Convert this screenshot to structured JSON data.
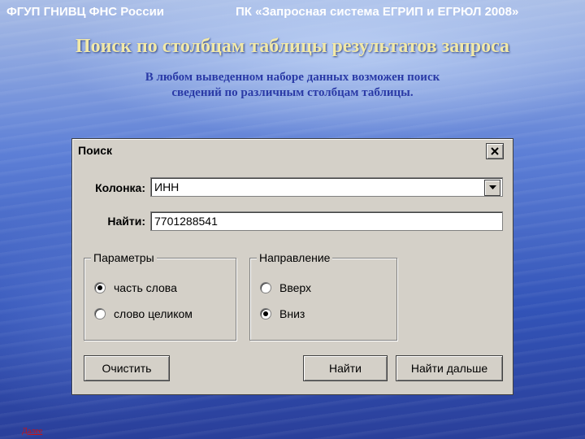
{
  "header": {
    "left": "ФГУП ГНИВЦ ФНС России",
    "right": "ПК «Запросная система ЕГРИП и ЕГРЮЛ 2008»"
  },
  "slide": {
    "title": "Поиск по столбцам таблицы результатов запроса",
    "subtitle": "В любом выведенном наборе данных возможен поиск сведений по различным столбцам таблицы."
  },
  "dialog": {
    "title": "Поиск",
    "column_label": "Колонка:",
    "column_value": "ИНН",
    "find_label": "Найти:",
    "find_value": "7701288541",
    "params_group": {
      "legend": "Параметры",
      "options": [
        {
          "label": "часть слова",
          "checked": true
        },
        {
          "label": "слово целиком",
          "checked": false
        }
      ]
    },
    "direction_group": {
      "legend": "Направление",
      "options": [
        {
          "label": "Вверх",
          "checked": false
        },
        {
          "label": "Вниз",
          "checked": true
        }
      ]
    },
    "buttons": {
      "clear": "Очистить",
      "find": "Найти",
      "find_next": "Найти дальше"
    }
  },
  "footer": {
    "next_link": "Далее"
  },
  "icons": {
    "close": "close-icon",
    "dropdown": "chevron-down-icon"
  },
  "colors": {
    "dialog_bg": "#d4d0c8",
    "title_text": "#f2e9a8",
    "subtitle_text": "#2a3aa6",
    "link": "#cc1111"
  }
}
